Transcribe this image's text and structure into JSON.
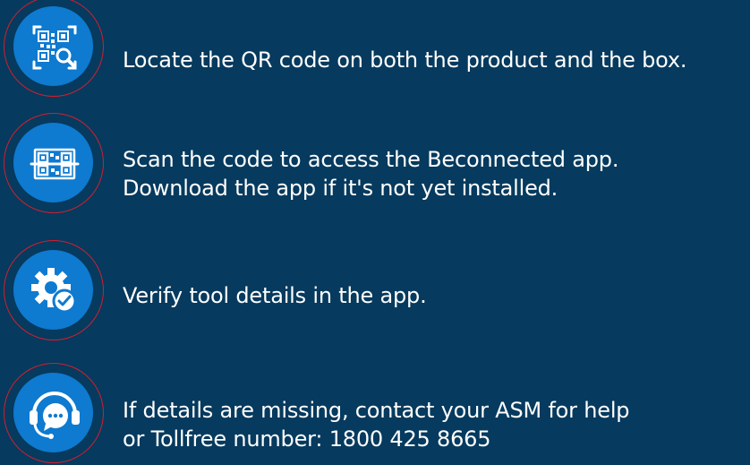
{
  "colors": {
    "background": "#063a5e",
    "icon_disc": "#0e7ad0",
    "ring": "#d0202e",
    "text": "#ffffff"
  },
  "steps": [
    {
      "icon": "qr-search-icon",
      "lines": [
        "Locate the QR code on both the product and the box."
      ]
    },
    {
      "icon": "qr-scan-icon",
      "lines": [
        "Scan the code to access the Beconnected app.",
        "Download the app if it's not yet installed."
      ]
    },
    {
      "icon": "gear-check-icon",
      "lines": [
        "Verify tool details in the app."
      ]
    },
    {
      "icon": "headset-chat-icon",
      "lines": [
        "If details are missing, contact your ASM for help",
        "or Tollfree number: 1800 425 8665"
      ]
    }
  ]
}
